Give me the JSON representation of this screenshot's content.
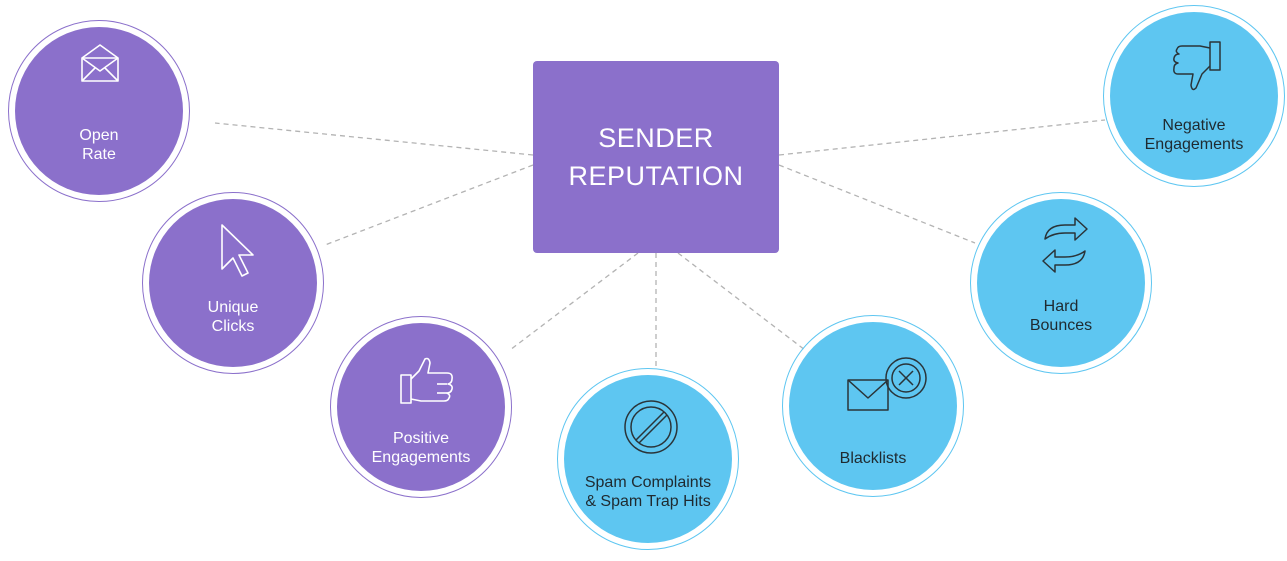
{
  "hub": {
    "line1": "SENDER",
    "line2": "REPUTATION"
  },
  "factors": {
    "open_rate": {
      "line1": "Open",
      "line2": "Rate",
      "icon": "envelope-open-icon"
    },
    "unique_clicks": {
      "line1": "Unique",
      "line2": "Clicks",
      "icon": "cursor-arrow-icon"
    },
    "positive_engagements": {
      "line1": "Positive",
      "line2": "Engagements",
      "icon": "thumbs-up-icon"
    },
    "spam_complaints": {
      "line1": "Spam Complaints",
      "line2": "& Spam Trap Hits",
      "icon": "prohibited-icon"
    },
    "blacklists": {
      "line1": "Blacklists",
      "icon": "envelope-blocked-icon"
    },
    "hard_bounces": {
      "line1": "Hard",
      "line2": "Bounces",
      "icon": "bounce-arrows-icon"
    },
    "negative_engagements": {
      "line1": "Negative",
      "line2": "Engagements",
      "icon": "thumbs-down-icon"
    }
  },
  "colors": {
    "positive_factor": "#8b70cb",
    "negative_factor": "#5ec6f1",
    "connector": "#b3b3b3"
  }
}
